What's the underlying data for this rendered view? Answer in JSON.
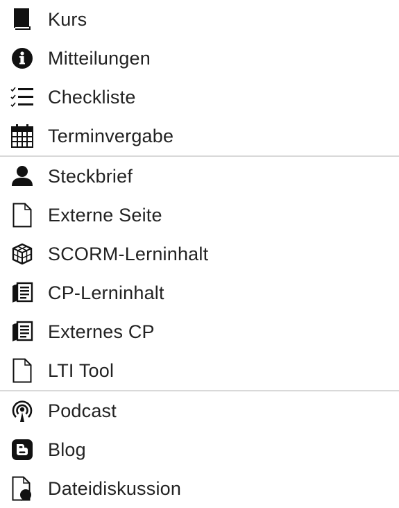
{
  "menu": {
    "groups": [
      {
        "items": [
          {
            "label": "Kurs",
            "icon": "book-icon"
          },
          {
            "label": "Mitteilungen",
            "icon": "info-icon"
          },
          {
            "label": "Checkliste",
            "icon": "checklist-icon"
          },
          {
            "label": "Terminvergabe",
            "icon": "calendar-icon"
          }
        ]
      },
      {
        "items": [
          {
            "label": "Steckbrief",
            "icon": "user-icon"
          },
          {
            "label": "Externe Seite",
            "icon": "page-icon"
          },
          {
            "label": "SCORM-Lerninhalt",
            "icon": "cube-icon"
          },
          {
            "label": "CP-Lerninhalt",
            "icon": "document-stack-icon"
          },
          {
            "label": "Externes CP",
            "icon": "document-stack-icon"
          },
          {
            "label": "LTI Tool",
            "icon": "page-icon"
          }
        ]
      },
      {
        "items": [
          {
            "label": "Podcast",
            "icon": "podcast-icon"
          },
          {
            "label": "Blog",
            "icon": "blog-icon"
          },
          {
            "label": "Dateidiskussion",
            "icon": "file-discussion-icon"
          }
        ]
      }
    ]
  }
}
